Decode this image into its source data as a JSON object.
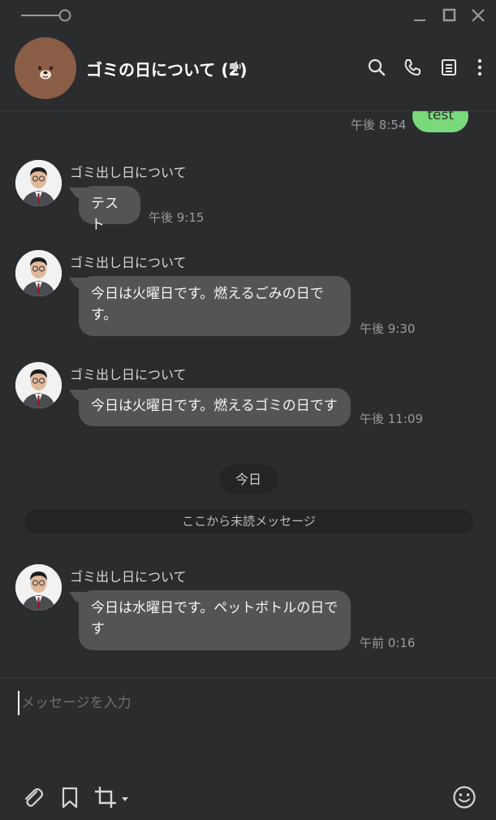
{
  "header": {
    "chat_title": "ゴミの日について (2)"
  },
  "messages": {
    "outgoing": {
      "text": "test",
      "time": "午後 8:54"
    },
    "incoming": [
      {
        "sender": "ゴミ出し日について",
        "text": "テスト",
        "time": "午後 9:15"
      },
      {
        "sender": "ゴミ出し日について",
        "text": "今日は火曜日です。燃えるごみの日です。",
        "time": "午後 9:30"
      },
      {
        "sender": "ゴミ出し日について",
        "text": "今日は火曜日です。燃えるゴミの日です",
        "time": "午後 11:09"
      },
      {
        "sender": "ゴミ出し日について",
        "text": "今日は水曜日です。ペットボトルの日です",
        "time": "午前 0:16"
      }
    ],
    "date_separator": "今日",
    "unread_marker": "ここから未読メッセージ"
  },
  "composer": {
    "placeholder": "メッセージを入力"
  },
  "icons": {
    "titlebar": [
      "slider-icon",
      "minimize-icon",
      "maximize-icon",
      "close-icon"
    ],
    "header": [
      "mute-icon",
      "search-icon",
      "phone-icon",
      "notes-icon",
      "more-icon"
    ],
    "toolbar": [
      "paperclip-icon",
      "bookmark-icon",
      "crop-icon",
      "emoji-icon"
    ]
  },
  "colors": {
    "background": "#2b2c2e",
    "incoming_bubble": "#545456",
    "outgoing_bubble": "#7ad97a",
    "timestamp": "#9a9a9a"
  }
}
